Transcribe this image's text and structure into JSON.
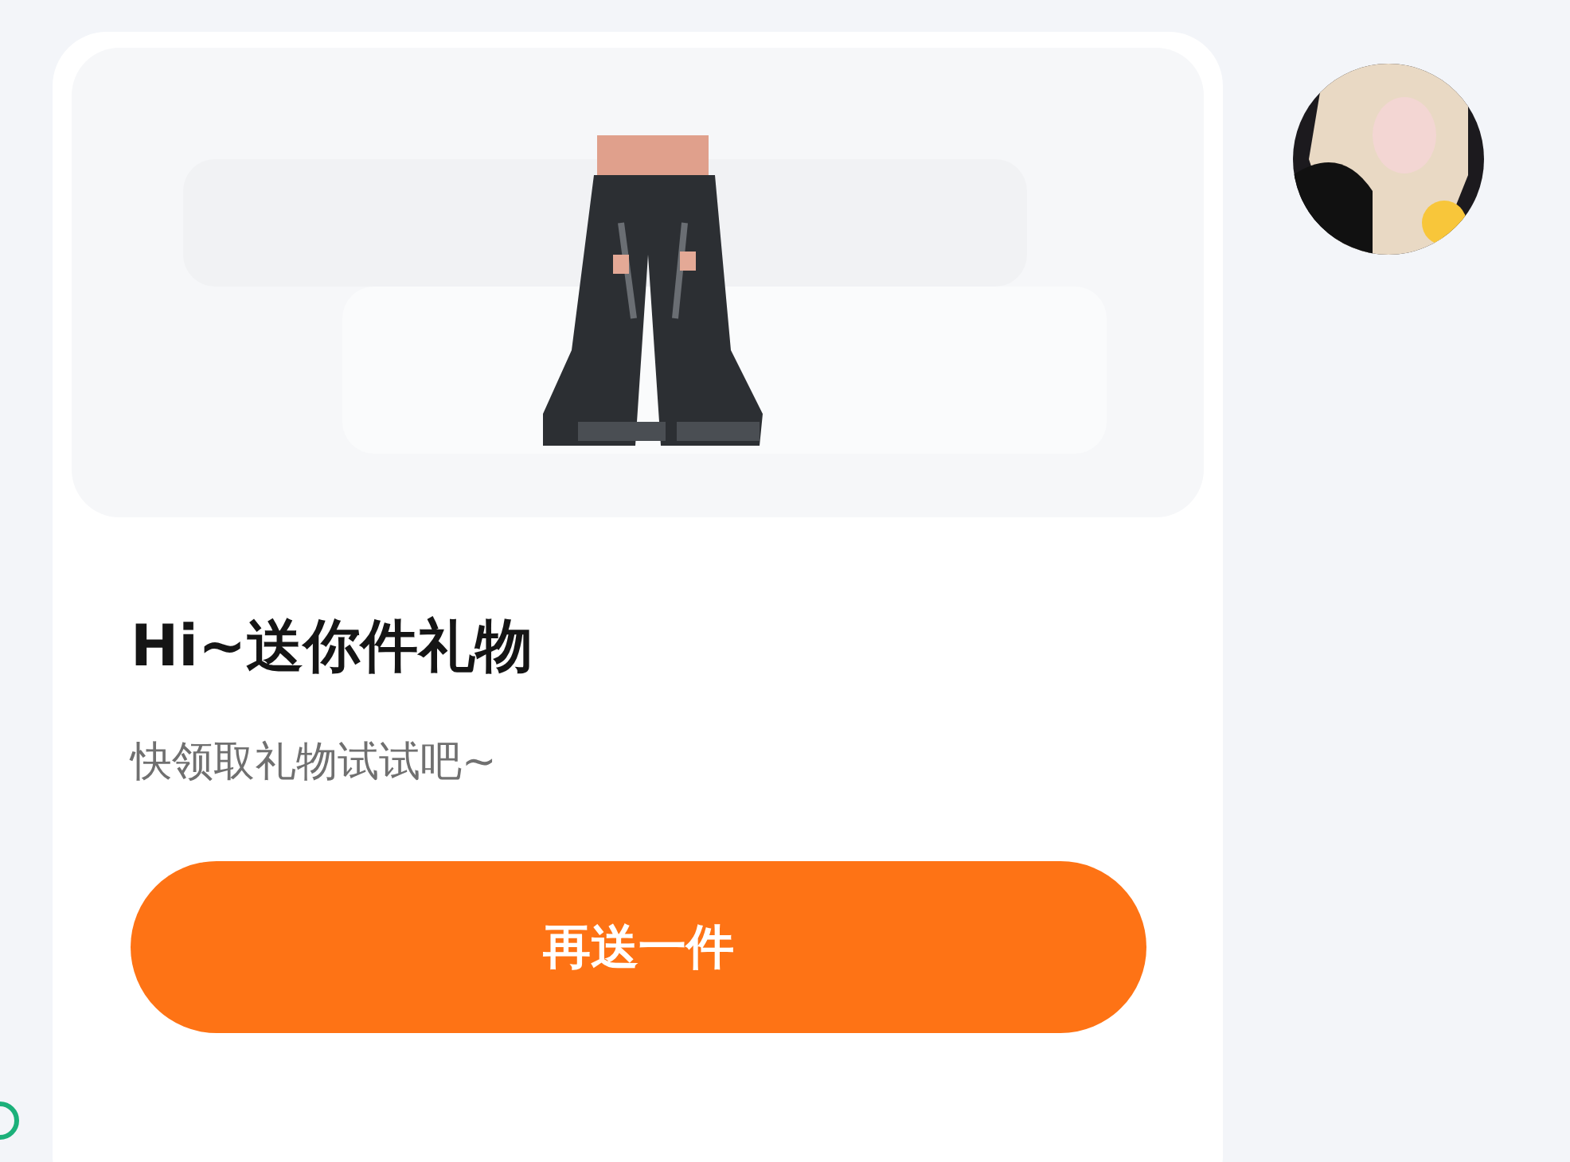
{
  "gift_card": {
    "title": "Hi~送你件礼物",
    "subtitle": "快领取礼物试试吧~",
    "button": "再送一件"
  }
}
